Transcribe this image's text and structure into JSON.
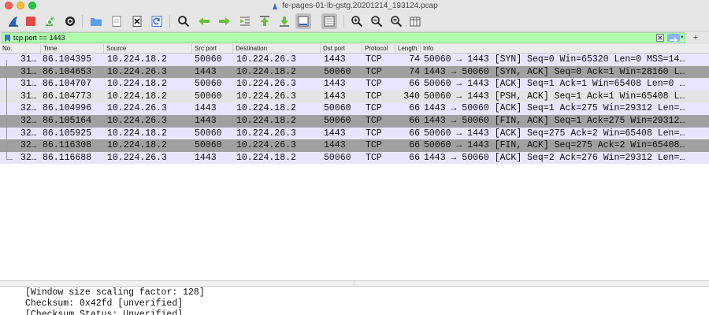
{
  "window": {
    "title": "fe-pages-01-lb-gstg.20201214_193124.pcap"
  },
  "toolbar": {
    "buttons": [
      {
        "name": "start-capture-button",
        "icon": "shark-fin-icon"
      },
      {
        "name": "stop-capture-button",
        "icon": "stop-icon"
      },
      {
        "name": "restart-capture-button",
        "icon": "restart-fin-icon"
      },
      {
        "name": "capture-options-button",
        "icon": "gear-icon"
      },
      {
        "name": "open-file-button",
        "icon": "folder-icon"
      },
      {
        "name": "save-file-button",
        "icon": "file-icon"
      },
      {
        "name": "close-file-button",
        "icon": "close-file-icon"
      },
      {
        "name": "reload-file-button",
        "icon": "reload-icon"
      },
      {
        "name": "find-packet-button",
        "icon": "search-icon"
      },
      {
        "name": "go-back-button",
        "icon": "arrow-left-icon"
      },
      {
        "name": "go-forward-button",
        "icon": "arrow-right-icon"
      },
      {
        "name": "go-to-packet-button",
        "icon": "goto-icon"
      },
      {
        "name": "first-packet-button",
        "icon": "arrow-up-bar-icon"
      },
      {
        "name": "last-packet-button",
        "icon": "arrow-down-bar-icon"
      },
      {
        "name": "autoscroll-button",
        "icon": "autoscroll-icon"
      },
      {
        "name": "colorize-button",
        "icon": "list-lines-icon"
      },
      {
        "name": "zoom-in-button",
        "icon": "zoom-in-icon"
      },
      {
        "name": "zoom-out-button",
        "icon": "zoom-out-icon"
      },
      {
        "name": "normal-size-button",
        "icon": "zoom-reset-icon"
      },
      {
        "name": "resize-columns-button",
        "icon": "resize-columns-icon"
      }
    ]
  },
  "filter": {
    "value": "tcp.port == 1443",
    "bookmark_icon": "bookmark-icon",
    "clear_icon": "clear-x-icon",
    "apply_icon": "apply-arrow-icon",
    "add_icon": "plus-icon",
    "add_label": "+",
    "color": "#afffaf"
  },
  "columns": [
    "No.",
    "Time",
    "Source",
    "Src port",
    "Destination",
    "Dst port",
    "Protocol",
    "Length",
    "Info"
  ],
  "packets": [
    {
      "no": "31…",
      "time": "86.104395",
      "src": "10.224.18.2",
      "sport": "50060",
      "dst": "10.224.26.3",
      "dport": "1443",
      "proto": "TCP",
      "len": "74",
      "info": "50060 → 1443 [SYN] Seq=0 Win=65320 Len=0 MSS=14…",
      "bg": "#e7e6fe"
    },
    {
      "no": "31…",
      "time": "86.104653",
      "src": "10.224.26.3",
      "sport": "1443",
      "dst": "10.224.18.2",
      "dport": "50060",
      "proto": "TCP",
      "len": "74",
      "info": "1443 → 50060 [SYN, ACK] Seq=0 Ack=1 Win=28160 L…",
      "bg": "#a0a0a0"
    },
    {
      "no": "31…",
      "time": "86.104707",
      "src": "10.224.18.2",
      "sport": "50060",
      "dst": "10.224.26.3",
      "dport": "1443",
      "proto": "TCP",
      "len": "66",
      "info": "50060 → 1443 [ACK] Seq=1 Ack=1 Win=65408 Len=0 …",
      "bg": "#e7e6fe"
    },
    {
      "no": "31…",
      "time": "86.104773",
      "src": "10.224.18.2",
      "sport": "50060",
      "dst": "10.224.26.3",
      "dport": "1443",
      "proto": "TCP",
      "len": "340",
      "info": "50060 → 1443 [PSH, ACK] Seq=1 Ack=1 Win=65408 L…",
      "bg": "#e4e4e4"
    },
    {
      "no": "32…",
      "time": "86.104996",
      "src": "10.224.26.3",
      "sport": "1443",
      "dst": "10.224.18.2",
      "dport": "50060",
      "proto": "TCP",
      "len": "66",
      "info": "1443 → 50060 [ACK] Seq=1 Ack=275 Win=29312 Len=…",
      "bg": "#e7e6fe"
    },
    {
      "no": "32…",
      "time": "86.105164",
      "src": "10.224.26.3",
      "sport": "1443",
      "dst": "10.224.18.2",
      "dport": "50060",
      "proto": "TCP",
      "len": "66",
      "info": "1443 → 50060 [FIN, ACK] Seq=1 Ack=275 Win=29312…",
      "bg": "#a0a0a0"
    },
    {
      "no": "32…",
      "time": "86.105925",
      "src": "10.224.18.2",
      "sport": "50060",
      "dst": "10.224.26.3",
      "dport": "1443",
      "proto": "TCP",
      "len": "66",
      "info": "50060 → 1443 [ACK] Seq=275 Ack=2 Win=65408 Len=…",
      "bg": "#e7e6fe"
    },
    {
      "no": "32…",
      "time": "86.116308",
      "src": "10.224.18.2",
      "sport": "50060",
      "dst": "10.224.26.3",
      "dport": "1443",
      "proto": "TCP",
      "len": "66",
      "info": "50060 → 1443 [FIN, ACK] Seq=275 Ack=2 Win=65408…",
      "bg": "#a0a0a0"
    },
    {
      "no": "32…",
      "time": "86.116688",
      "src": "10.224.26.3",
      "sport": "1443",
      "dst": "10.224.18.2",
      "dport": "50060",
      "proto": "TCP",
      "len": "66",
      "info": "1443 → 50060 [ACK] Seq=2 Ack=276 Win=29312 Len=…",
      "bg": "#e7e6fe"
    }
  ],
  "details": {
    "lines": [
      "[Window size scaling factor: 128]",
      "Checksum: 0x42fd [unverified]",
      "[Checksum Status: Unverified]"
    ]
  },
  "colors": {
    "tcp_row": "#e7e6fe",
    "tcp_syn_fin_row": "#a0a0a0",
    "selected_row": "#e4e4e4",
    "toolbar_bg": "#e6e6e6"
  }
}
